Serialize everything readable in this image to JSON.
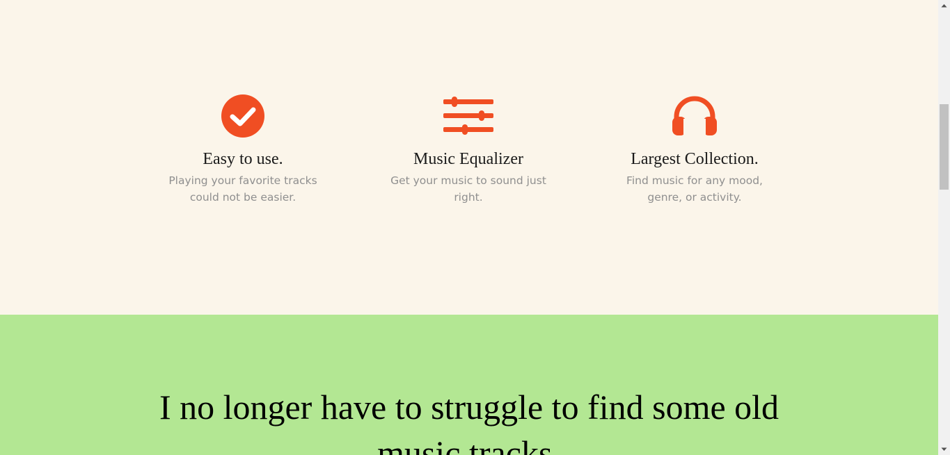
{
  "colors": {
    "features_bg": "#fbf5ea",
    "accent": "#f04e23",
    "testimonial_bg": "#b3e793",
    "muted_text": "#8f8f8f"
  },
  "features": [
    {
      "icon": "check-circle-icon",
      "title": "Easy to use.",
      "description": "Playing your favorite tracks could not be easier."
    },
    {
      "icon": "sliders-icon",
      "title": "Music Equalizer",
      "description": "Get your music to sound just right."
    },
    {
      "icon": "headphones-icon",
      "title": "Largest Collection.",
      "description": "Find music for any mood, genre, or activity."
    }
  ],
  "testimonial": {
    "quote": "I no longer have to struggle to find some old music tracks."
  }
}
